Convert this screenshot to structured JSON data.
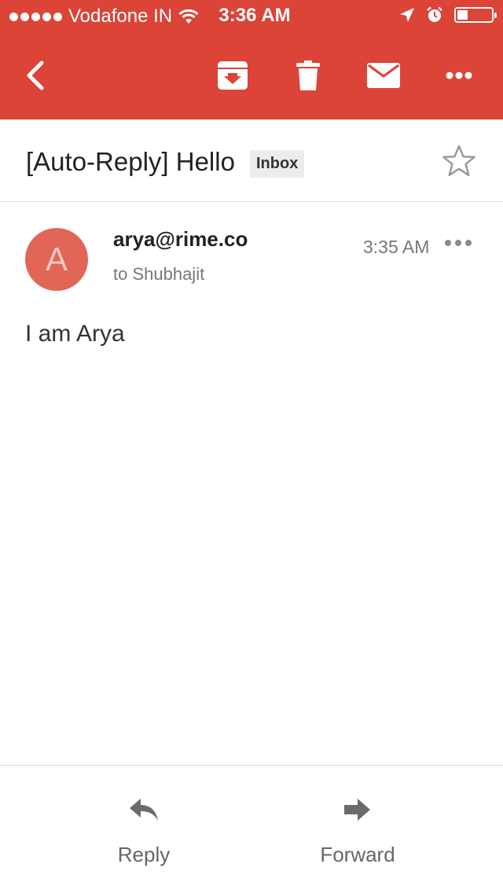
{
  "status_bar": {
    "carrier": "Vodafone IN",
    "time": "3:36 AM",
    "battery_level": 0.3,
    "icons": [
      "signal-dots-icon",
      "wifi-icon",
      "location-arrow-icon",
      "alarm-icon",
      "battery-icon"
    ]
  },
  "toolbar": {
    "icons": [
      "back-icon",
      "archive-icon",
      "delete-icon",
      "mark-unread-icon",
      "more-options-icon"
    ]
  },
  "thread": {
    "subject": "[Auto-Reply] Hello",
    "label": "Inbox",
    "starred": false
  },
  "message": {
    "avatar_initial": "A",
    "avatar_color": "#e16656",
    "sender": "arya@rime.co",
    "recipient": "to Shubhajit",
    "time": "3:35 AM",
    "body": "I am Arya"
  },
  "actions": {
    "reply_label": "Reply",
    "forward_label": "Forward"
  },
  "colors": {
    "accent": "#db4437"
  }
}
